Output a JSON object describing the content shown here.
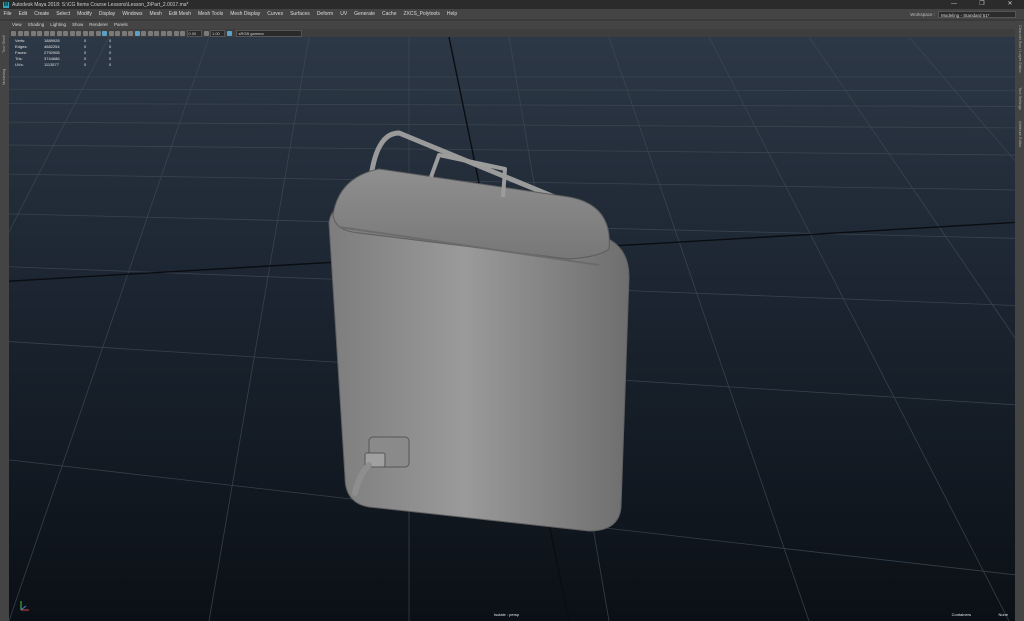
{
  "window": {
    "title": "Autodesk Maya 2018: S:\\CG Items Course Lessons\\Lesson_3\\Part_2.0017.ma*",
    "logo_text": "M",
    "minimize": "—",
    "maximize": "❐",
    "close": "✕"
  },
  "menubar": {
    "items": [
      "File",
      "Edit",
      "Create",
      "Select",
      "Modify",
      "Display",
      "Windows",
      "Mesh",
      "Edit Mesh",
      "Mesh Tools",
      "Mesh Display",
      "Curves",
      "Surfaces",
      "Deform",
      "UV",
      "Generate",
      "Cache",
      "ZXCS_Polytools",
      "Help"
    ],
    "workspace_label": "Workspace :",
    "workspace_value": "Modeling - Standard 51*"
  },
  "panel_menu": {
    "items": [
      "View",
      "Shading",
      "Lighting",
      "Show",
      "Renderer",
      "Panels"
    ]
  },
  "panel_toolbar": {
    "exposure": "0.00",
    "gamma": "1.00",
    "color_space": "sRGB gamma"
  },
  "left_strip": {
    "tabs": [
      "Tool Shelf",
      "Modeling"
    ]
  },
  "right_strip": {
    "tabs": [
      "Channel Box / Layer Editor",
      "Tool Settings",
      "Attribute Editor"
    ]
  },
  "hud": {
    "rows": [
      {
        "label": "Verts:",
        "v1": "1889928",
        "v2": "0",
        "v3": "0"
      },
      {
        "label": "Edges:",
        "v1": "4682254",
        "v2": "0",
        "v3": "0"
      },
      {
        "label": "Faces:",
        "v1": "2792908",
        "v2": "0",
        "v3": "0"
      },
      {
        "label": "Tris:",
        "v1": "3744686",
        "v2": "0",
        "v3": "0"
      },
      {
        "label": "UVs:",
        "v1": "1113577",
        "v2": "0",
        "v3": "0"
      }
    ]
  },
  "viewport": {
    "camera_label": "Isolate : persp",
    "containers_label": "Containers",
    "none_label": "None"
  },
  "colors": {
    "viewport_top": "#2d3846",
    "viewport_bottom": "#0b1016",
    "model": "#8c8c8c",
    "accent": "#5aa0c8"
  }
}
